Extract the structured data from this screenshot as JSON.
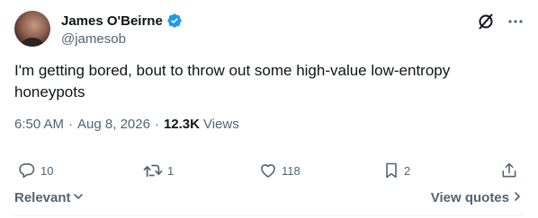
{
  "author": {
    "display_name": "James O'Beirne",
    "handle": "@jamesob",
    "verified": true,
    "avatar_icon": "user-avatar"
  },
  "tweet": {
    "text": "I'm getting bored, bout to throw out some high-value low-entropy honeypots"
  },
  "meta": {
    "time": "6:50 AM",
    "date": "Aug 8, 2026",
    "views_count": "12.3K",
    "views_label": "Views",
    "separator": "·"
  },
  "actions": {
    "replies": "10",
    "reposts": "1",
    "likes": "118",
    "bookmarks": "2"
  },
  "footer": {
    "sort_label": "Relevant",
    "view_quotes_label": "View quotes"
  },
  "colors": {
    "text_primary": "#0f1419",
    "text_secondary": "#536471",
    "verified_blue": "#1d9bf0",
    "divider": "#eff3f4"
  }
}
